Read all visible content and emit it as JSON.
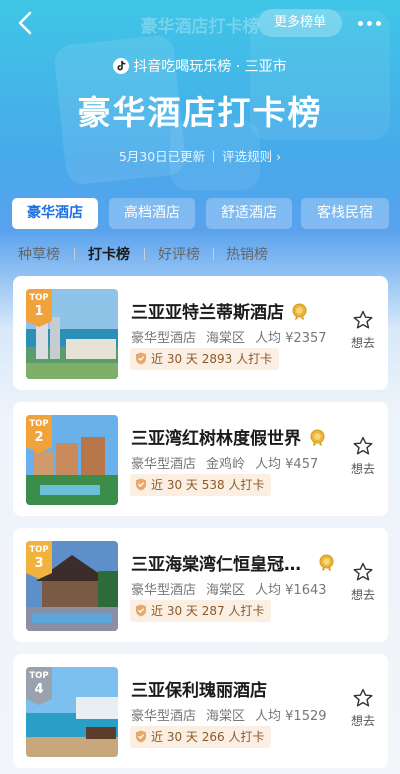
{
  "header": {
    "faded_title": "豪华酒店打卡榜",
    "more_lists_label": "更多榜单",
    "brand_line": "抖音吃喝玩乐榜 · 三亚市",
    "title": "豪华酒店打卡榜",
    "updated": "5月30日已更新",
    "rules": "评选规则"
  },
  "category_tabs": [
    {
      "label": "豪华酒店",
      "active": true
    },
    {
      "label": "高档酒店",
      "active": false
    },
    {
      "label": "舒适酒店",
      "active": false
    },
    {
      "label": "客栈民宿",
      "active": false
    }
  ],
  "sub_tabs": [
    {
      "label": "种草榜",
      "active": false
    },
    {
      "label": "打卡榜",
      "active": true
    },
    {
      "label": "好评榜",
      "active": false
    },
    {
      "label": "热销榜",
      "active": false
    }
  ],
  "hotels": [
    {
      "rank_label": "TOP",
      "rank": "1",
      "name": "三亚亚特兰蒂斯酒店",
      "type": "豪华型酒店",
      "area": "海棠区",
      "price": "人均 ¥2357",
      "checkins": "近 30 天 2893 人打卡",
      "fav_label": "想去"
    },
    {
      "rank_label": "TOP",
      "rank": "2",
      "name": "三亚湾红树林度假世界",
      "type": "豪华型酒店",
      "area": "金鸡岭",
      "price": "人均 ¥457",
      "checkins": "近 30 天 538 人打卡",
      "fav_label": "想去"
    },
    {
      "rank_label": "TOP",
      "rank": "3",
      "name": "三亚海棠湾仁恒皇冠…",
      "type": "豪华型酒店",
      "area": "海棠区",
      "price": "人均 ¥1643",
      "checkins": "近 30 天 287 人打卡",
      "fav_label": "想去"
    },
    {
      "rank_label": "TOP",
      "rank": "4",
      "name": "三亚保利瑰丽酒店",
      "type": "豪华型酒店",
      "area": "海棠区",
      "price": "人均 ¥1529",
      "checkins": "近 30 天 266 人打卡",
      "fav_label": "想去"
    }
  ],
  "colors": {
    "accent": "#1e6fe0",
    "rank_gold": "#f2a23a",
    "rank_silver": "#9aa3ad",
    "checkin_bg": "#fbefe3",
    "checkin_text": "#8a5a2a"
  },
  "icons": {
    "back": "back-arrow-icon",
    "more": "more-dots-icon",
    "brand": "douyin-logo-icon",
    "medal": "gold-medal-icon",
    "shield": "shield-check-icon",
    "favorite": "star-outline-icon"
  }
}
